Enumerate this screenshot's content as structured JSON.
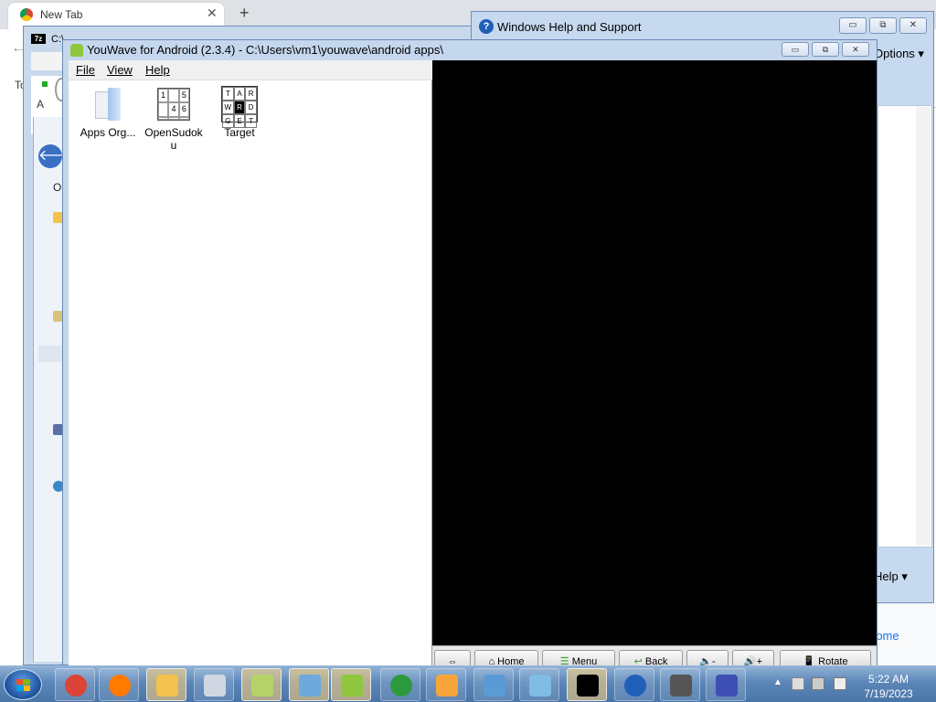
{
  "chrome": {
    "tab_title": "New Tab",
    "close_glyph": "✕",
    "new_tab_glyph": "+",
    "left_text_1": "To",
    "left_text_2": "A",
    "link_text": "rome"
  },
  "zip_window": {
    "title": "C:\\",
    "logo": "7z",
    "left_text": "Or",
    "back_glyph": "🡐"
  },
  "help_window": {
    "title": "Windows Help and Support",
    "options_label": "Options",
    "help_label": "Help",
    "min_glyph": "▭",
    "max_glyph": "⧉",
    "close_glyph": "✕"
  },
  "youwave": {
    "title": "YouWave for Android (2.3.4) - C:\\Users\\vm1\\youwave\\android apps\\",
    "menu": [
      {
        "label": "File"
      },
      {
        "label": "View"
      },
      {
        "label": "Help"
      }
    ],
    "apps": [
      {
        "label": "Apps Org...",
        "icon": "apps-organizer-icon"
      },
      {
        "label": "OpenSudoku",
        "icon": "sudoku-icon"
      },
      {
        "label": "Target",
        "icon": "target-word-icon"
      }
    ],
    "nav_buttons": [
      {
        "label": "",
        "icon": "arrows-icon"
      },
      {
        "label": "Home",
        "icon": "home-icon"
      },
      {
        "label": "Menu",
        "icon": "menu-icon"
      },
      {
        "label": "Back",
        "icon": "back-icon"
      },
      {
        "label": "-",
        "icon": "volume-down-icon"
      },
      {
        "label": "+",
        "icon": "volume-up-icon"
      },
      {
        "label": "Rotate",
        "icon": "rotate-icon"
      }
    ],
    "sudoku_digits": [
      "1",
      "",
      "5",
      "",
      "4",
      "6",
      "",
      "",
      ""
    ],
    "target_letters": [
      "T",
      "A",
      "R",
      "W",
      "R",
      "D",
      "G",
      "E",
      "T"
    ]
  },
  "taskbar": {
    "apps": [
      {
        "name": "chrome-icon",
        "color": "#db4437"
      },
      {
        "name": "firefox-icon",
        "color": "#ff7a00"
      },
      {
        "name": "explorer-icon",
        "color": "#f2c14e"
      },
      {
        "name": "calculator-icon",
        "color": "#d0d7e2"
      },
      {
        "name": "folders-icon",
        "color": "#b5d36a"
      },
      {
        "name": "keyboard-icon",
        "color": "#6fa8dc"
      },
      {
        "name": "android-icon",
        "color": "#8ec63f"
      },
      {
        "name": "windows-icon",
        "color": "#2e9a3e"
      },
      {
        "name": "media-player-icon",
        "color": "#f7a53b"
      },
      {
        "name": "remote-desktop-icon",
        "color": "#5b9bd5"
      },
      {
        "name": "control-panel-icon",
        "color": "#7fbce6"
      },
      {
        "name": "7zip-icon",
        "color": "#000000"
      },
      {
        "name": "help-icon",
        "color": "#1f5fb8"
      },
      {
        "name": "microphone-icon",
        "color": "#555555"
      },
      {
        "name": "infinity-icon",
        "color": "#3e4fb3"
      }
    ],
    "time": "5:22 AM",
    "date": "7/19/2023"
  }
}
